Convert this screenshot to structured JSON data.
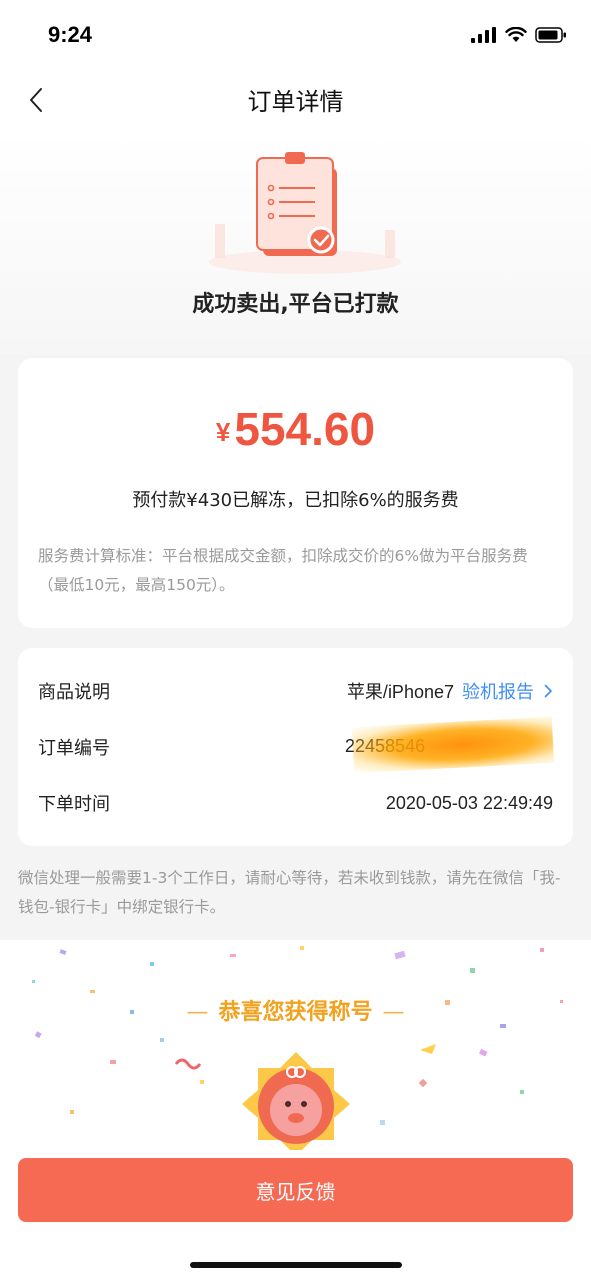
{
  "status_bar": {
    "time": "9:24"
  },
  "nav": {
    "title": "订单详情",
    "back_icon": "chevron-left-icon"
  },
  "hero": {
    "status": "成功卖出,平台已打款",
    "icon": "clipboard-check-icon"
  },
  "amount_card": {
    "currency": "¥",
    "amount": "554.60",
    "deposit_note": "预付款¥430已解冻，已扣除6%的服务费",
    "fee_rule": "服务费计算标准：平台根据成交金额，扣除成交价的6%做为平台服务费（最低10元，最高150元）。"
  },
  "order_info": {
    "rows": [
      {
        "label": "商品说明",
        "value": "苹果/iPhone7",
        "link": "验机报告"
      },
      {
        "label": "订单编号",
        "value": "22458546"
      },
      {
        "label": "下单时间",
        "value": "2020-05-03 22:49:49"
      }
    ]
  },
  "wechat_note": "微信处理一般需要1-3个工作日，请耐心等待，若未收到钱款，请先在微信「我-钱包-银行卡」中绑定银行卡。",
  "celebration": {
    "title": "恭喜您获得称号",
    "dash": "—",
    "badge_icon": "pig-badge-icon"
  },
  "feedback_button": "意见反馈",
  "colors": {
    "accent": "#ef5640",
    "button": "#f66a54",
    "link": "#3e8ef7",
    "gold": "#f2a21f"
  }
}
